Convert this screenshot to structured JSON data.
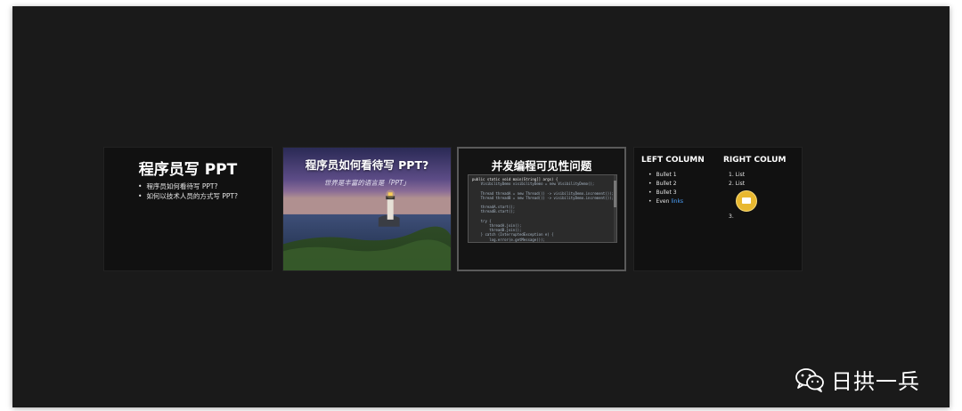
{
  "slides": [
    {
      "title": "程序员写 PPT",
      "bullets": [
        "程序员如何看待写 PPT?",
        "如何以技术人员的方式写 PPT?"
      ]
    },
    {
      "title": "程序员如何看待写 PPT?",
      "subtitle": "世界是丰富的语言是「PPT」"
    },
    {
      "title": "并发编程可见性问题",
      "code": [
        "public static void main(String[] args) {",
        "    VisibilityDemo visibilityDemo = new VisibilityDemo();",
        "",
        "    Thread threadA = new Thread(() -> visibilityDemo.increment());",
        "    Thread threadB = new Thread(() -> visibilityDemo.increment());",
        "",
        "    threadA.start();",
        "    threadB.start();",
        "",
        "    try {",
        "        threadA.join();",
        "        threadB.join();",
        "    } catch (InterruptedException e) {",
        "        log.error(e.getMessage());"
      ]
    },
    {
      "left_heading": "LEFT COLUMN",
      "left_items": [
        "Bullet 1",
        "Bullet 2",
        "Bullet 3"
      ],
      "left_last_prefix": "Even",
      "left_last_link": "links",
      "right_heading": "RIGHT COLUM",
      "right_items": [
        "1. List",
        "2. List"
      ],
      "right_after_image": "3."
    }
  ],
  "watermark": {
    "text": "日拱一兵",
    "icon": "wechat-icon"
  }
}
